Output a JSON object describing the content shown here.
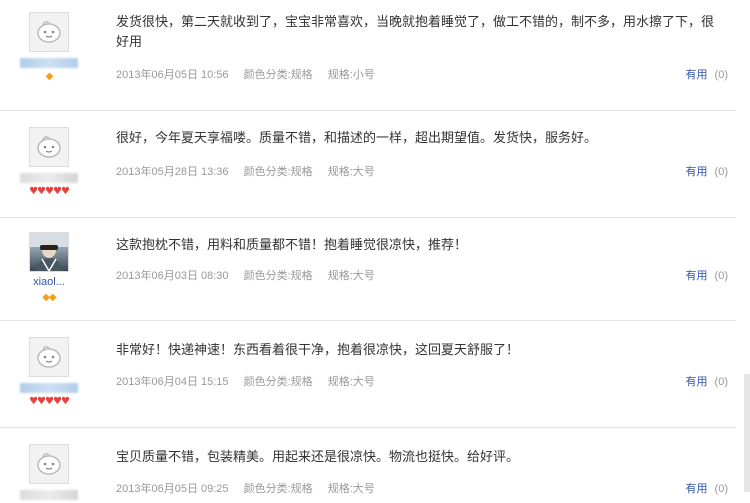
{
  "reviews": [
    {
      "comment": "发货很快，第二天就收到了，宝宝非常喜欢，当晚就抱着睡觉了，做工不错的，制不多，用水擦了下，很好用",
      "date": "2013年06月05日 10:56",
      "color": "颜色分类:规格",
      "spec": "规格:小号",
      "useful_label": "有用",
      "useful_count": "(0)",
      "rank": "◆",
      "avatar_icon": "face-icon"
    },
    {
      "comment": "很好，今年夏天享福喽。质量不错，和描述的一样，超出期望值。发货快，服务好。",
      "date": "2013年05月28日 13:36",
      "color": "颜色分类:规格",
      "spec": "规格:大号",
      "useful_label": "有用",
      "useful_count": "(0)",
      "rank": "♥♥♥♥♥",
      "avatar_icon": "face-icon"
    },
    {
      "comment": "这款抱枕不错，用料和质量都不错！抱着睡觉很凉快，推荐！",
      "date": "2013年06月03日 08:30",
      "color": "颜色分类:规格",
      "spec": "规格:大号",
      "useful_label": "有用",
      "useful_count": "(0)",
      "username": "xiaol...",
      "rank": "◆◆",
      "avatar_icon": "photo-avatar"
    },
    {
      "comment": "非常好！快递神速！东西看着很干净，抱着很凉快，这回夏天舒服了！",
      "date": "2013年06月04日 15:15",
      "color": "颜色分类:规格",
      "spec": "规格:大号",
      "useful_label": "有用",
      "useful_count": "(0)",
      "rank": "♥♥♥♥♥",
      "avatar_icon": "face-icon"
    },
    {
      "comment": "宝贝质量不错，包装精美。用起来还是很凉快。物流也挺快。给好评。",
      "date": "2013年06月05日 09:25",
      "color": "颜色分类:规格",
      "spec": "规格:大号",
      "useful_label": "有用",
      "useful_count": "(0)",
      "avatar_icon": "face-icon"
    }
  ]
}
